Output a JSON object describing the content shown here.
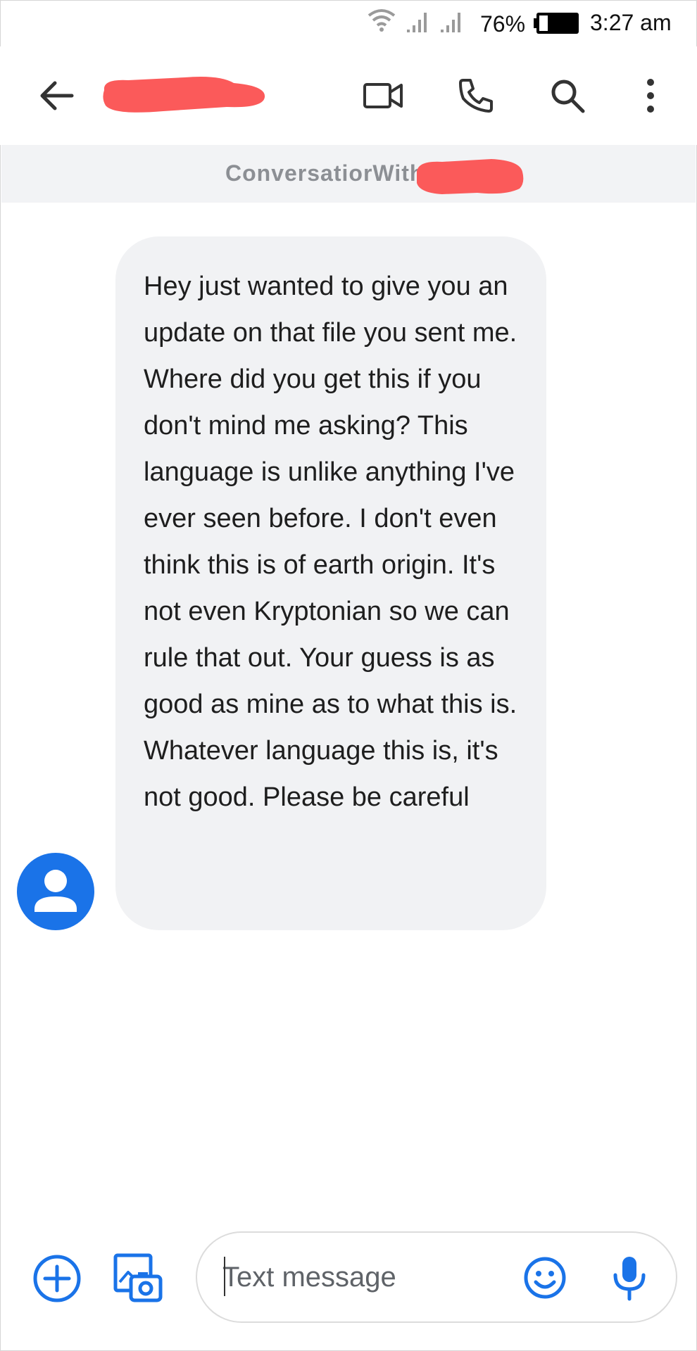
{
  "status_bar": {
    "battery_percent": "76%",
    "time": "3:27 am",
    "icons": [
      "wifi-icon",
      "signal-icon",
      "signal-icon",
      "battery-icon"
    ]
  },
  "app_bar": {
    "icons": [
      "back-arrow-icon",
      "video-camera-icon",
      "phone-icon",
      "search-icon",
      "more-vertical-icon"
    ],
    "redaction_color": "#fb5a5a"
  },
  "banner": {
    "text": "ConversatiorWith"
  },
  "message": {
    "text": "Hey just wanted to give you an update on that  file you sent me. Where did you get this if you don't mind me asking? This language  is unlike  anything I've ever seen before. I don't even think this is of earth origin. It's not even Kryptonian so we can rule that out. Your guess is as good as mine as to what this is. Whatever language  this is, it's not good. Please be careful",
    "bubble_color": "#f1f2f4"
  },
  "avatar": {
    "icon": "person-icon",
    "color": "#1a73e8"
  },
  "compose": {
    "placeholder": "Text message",
    "value": "",
    "icons": [
      "add-circle-icon",
      "gallery-icon",
      "emoji-icon",
      "mic-icon"
    ],
    "accent": "#1a73e8"
  }
}
